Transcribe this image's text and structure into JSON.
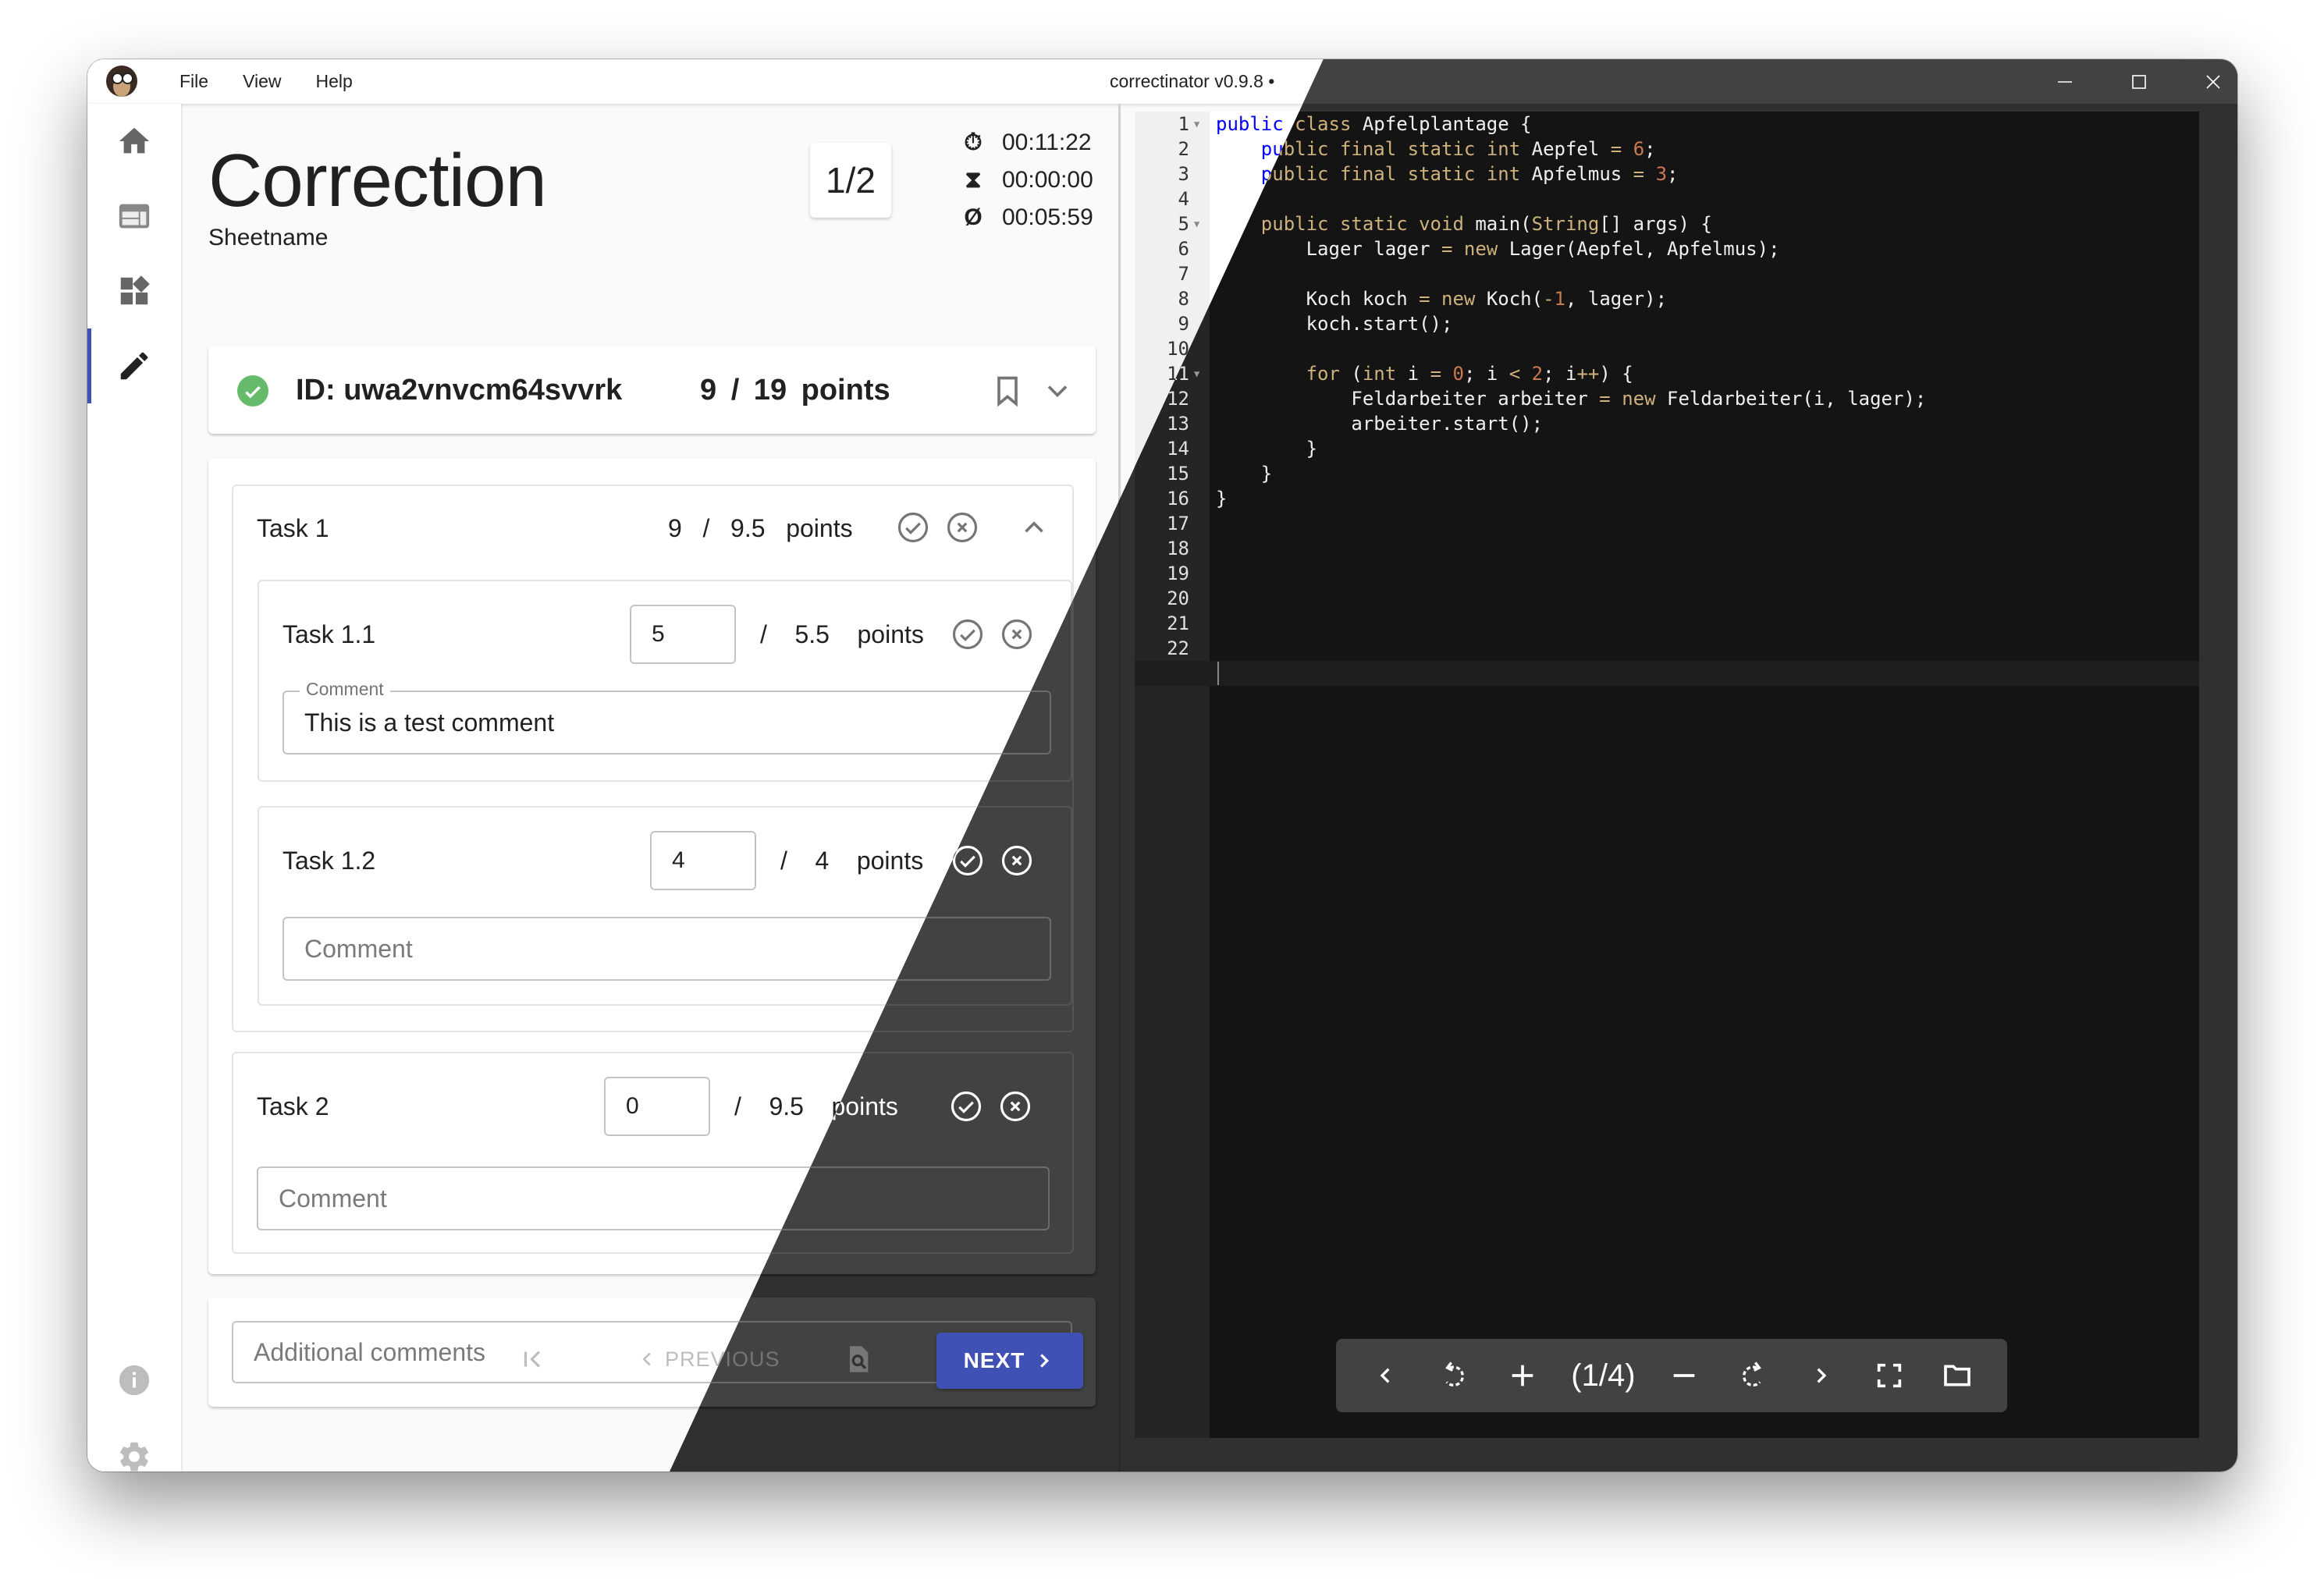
{
  "window": {
    "title": "correctinator v0.9.8 •",
    "menu": [
      "File",
      "View",
      "Help"
    ],
    "controls": [
      "minimize",
      "maximize",
      "close"
    ]
  },
  "sidebar": {
    "items": [
      {
        "name": "home",
        "icon": "home-icon"
      },
      {
        "name": "sheets",
        "icon": "web-layout-icon"
      },
      {
        "name": "overview",
        "icon": "widgets-icon"
      },
      {
        "name": "correction",
        "icon": "pencil-icon",
        "active": true
      }
    ],
    "bottom": [
      {
        "name": "info",
        "icon": "info-icon"
      },
      {
        "name": "settings",
        "icon": "gear-icon"
      }
    ]
  },
  "header": {
    "title": "Correction",
    "subtitle": "Sheetname",
    "counter": "1/2",
    "timers": [
      {
        "icon": "stopwatch-icon",
        "value": "00:11:22"
      },
      {
        "icon": "hourglass-icon",
        "value": "00:00:00"
      },
      {
        "icon": "average-icon",
        "symbol": "Ø",
        "value": "00:05:59"
      }
    ]
  },
  "submission": {
    "id_label": "ID:  uwa2vnvcm64svvrk",
    "points_text": "9 / 19 points",
    "status": "done",
    "status_color": "#66bb6a"
  },
  "tasks": [
    {
      "name": "Task 1",
      "points_text": "9   /   9.5   points",
      "expanded": true,
      "subtasks": [
        {
          "name": "Task 1.1",
          "value": "5",
          "max_text": "/    5.5    points",
          "comment_label": "Comment",
          "comment": "This is a test comment"
        },
        {
          "name": "Task 1.2",
          "value": "4",
          "max_text": "/    4    points",
          "comment_placeholder": "Comment",
          "comment": ""
        }
      ]
    },
    {
      "name": "Task 2",
      "value": "0",
      "max_text": "/    9.5    points",
      "comment_placeholder": "Comment",
      "comment": ""
    }
  ],
  "additional_comments": {
    "placeholder": "Additional comments",
    "value": ""
  },
  "navigation": {
    "first_label": "",
    "previous_label": "PREVIOUS",
    "next_label": "NEXT",
    "last_label": ""
  },
  "accent_color": "#3f51b5",
  "editor": {
    "line_count": 23,
    "fold_lines": [
      1,
      5,
      11
    ],
    "active_line": 23,
    "lines": [
      "public class Apfelplantage {",
      "    public final static int Aepfel = 6;",
      "    public final static int Apfelmus = 3;",
      "",
      "    public static void main(String[] args) {",
      "        Lager lager = new Lager(Aepfel, Apfelmus);",
      "",
      "        Koch koch = new Koch(-1, lager);",
      "        koch.start();",
      "",
      "        for (int i = 0; i < 2; i++) {",
      "            Feldarbeiter arbeiter = new Feldarbeiter(i, lager);",
      "            arbeiter.start();",
      "        }",
      "    }",
      "}",
      "",
      "",
      "",
      "",
      "",
      "",
      ""
    ]
  },
  "viewer": {
    "page_indicator": "(1/4)",
    "buttons": [
      "previous-page",
      "rotate-left",
      "zoom-in",
      "zoom-out",
      "rotate-right",
      "next-page",
      "fullscreen",
      "open-folder"
    ]
  }
}
